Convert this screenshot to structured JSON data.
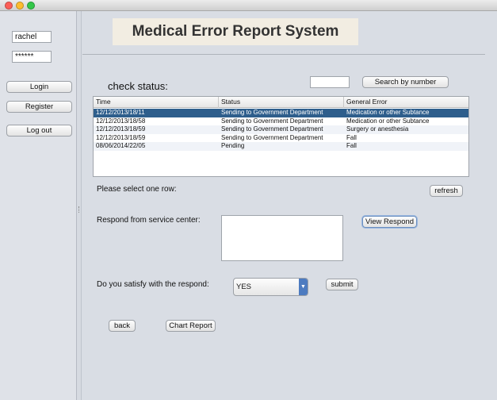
{
  "window": {
    "title": ""
  },
  "login": {
    "username": "rachel",
    "password": "******"
  },
  "sidebar": {
    "login_label": "Login",
    "register_label": "Register",
    "logout_label": "Log out"
  },
  "header": {
    "title": "Medical Error Report System"
  },
  "status": {
    "check_label": "check status:",
    "search_value": "",
    "search_button": "Search by number",
    "table": {
      "columns": [
        "Time",
        "Status",
        "General Error"
      ],
      "rows": [
        [
          "12/12/2013/18/11",
          "Sending to Government Department",
          "Medication or other Subtance"
        ],
        [
          "12/12/2013/18/58",
          "Sending to Government Department",
          "Medication or other Subtance"
        ],
        [
          "12/12/2013/18/59",
          "Sending to Government Department",
          "Surgery or anesthesia"
        ],
        [
          "12/12/2013/18/59",
          "Sending to Government Department",
          "Fall"
        ],
        [
          "08/06/2014/22/05",
          "Pending",
          "Fall"
        ]
      ],
      "selected_row": 0
    },
    "select_prompt": "Please select one row:",
    "refresh_button": "refresh"
  },
  "respond": {
    "label": "Respond from service center:",
    "text": "",
    "view_button": "View Respond"
  },
  "satisfy": {
    "label": "Do you satisfy with the respond:",
    "selected": "YES",
    "submit_button": "submit"
  },
  "footer": {
    "back_button": "back",
    "chart_button": "Chart Report"
  }
}
